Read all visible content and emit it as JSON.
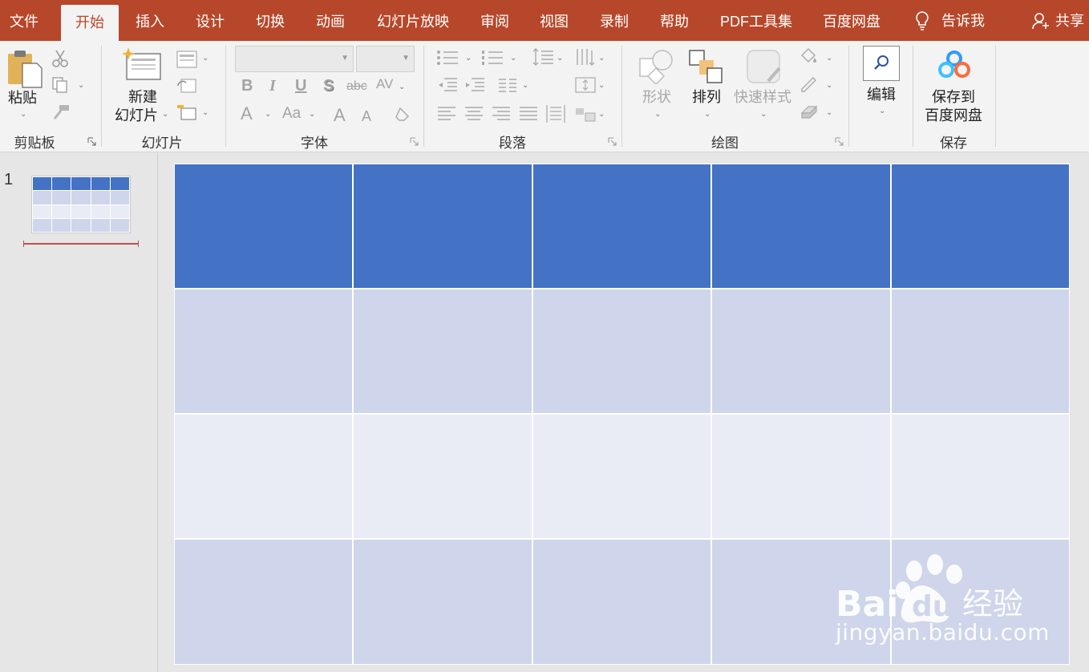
{
  "tabs": {
    "file": "文件",
    "home": "开始",
    "insert": "插入",
    "design": "设计",
    "transitions": "切换",
    "animations": "动画",
    "slideshow": "幻灯片放映",
    "review": "审阅",
    "view": "视图",
    "record": "录制",
    "help": "帮助",
    "pdf_tools": "PDF工具集",
    "baidu_pan": "百度网盘",
    "tell_me": "告诉我",
    "share": "共享"
  },
  "ribbon": {
    "clipboard": {
      "paste_label": "粘贴",
      "group_label": "剪贴板"
    },
    "slides": {
      "new_slide_line1": "新建",
      "new_slide_line2": "幻灯片",
      "group_label": "幻灯片"
    },
    "font": {
      "group_label": "字体",
      "font_name": "",
      "font_size": "",
      "bold": "B",
      "italic": "I",
      "underline": "U",
      "shadow": "S",
      "strike": "abc",
      "spacing": "AV",
      "font_color": "A",
      "change_case": "Aa",
      "grow": "A",
      "shrink": "A"
    },
    "paragraph": {
      "group_label": "段落"
    },
    "drawing": {
      "shapes_label": "形状",
      "arrange_label": "排列",
      "quick_styles_label": "快速样式",
      "group_label": "绘图"
    },
    "editing": {
      "label": "编辑"
    },
    "save": {
      "line1": "保存到",
      "line2": "百度网盘",
      "group_label": "保存"
    }
  },
  "thumbnails": [
    {
      "number": "1"
    }
  ],
  "slide_table": {
    "columns": 5,
    "rows": 4,
    "header_color": "#4472c4",
    "band_color_a": "#cfd5ea",
    "band_color_b": "#e9ebf5"
  },
  "watermark": {
    "text": "jingyan.baidu.com",
    "logo": "Baidu 经验"
  },
  "colors": {
    "accent": "#b7472a",
    "ribbon_bg": "#f3f3f3"
  }
}
